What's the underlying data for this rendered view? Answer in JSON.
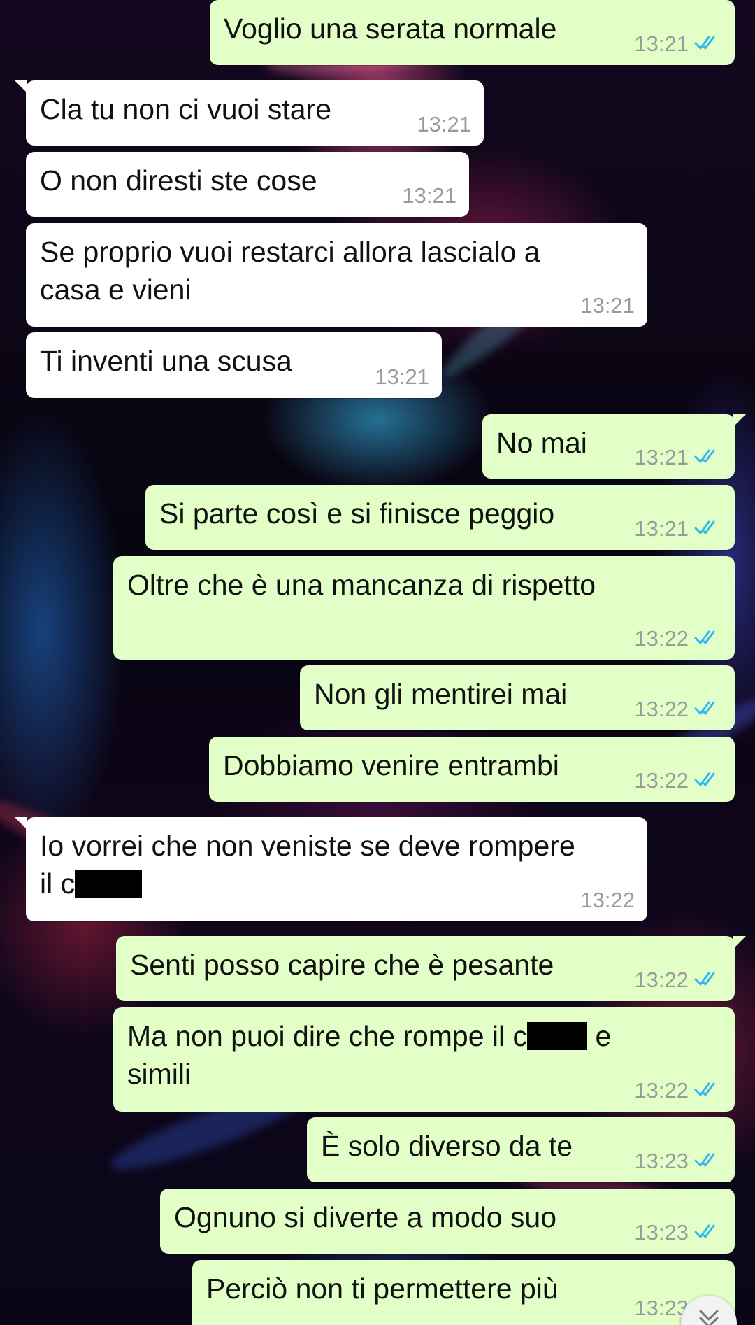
{
  "messages": [
    {
      "dir": "out",
      "text": "Voglio una serata normale",
      "time": "13:21",
      "status": "read"
    },
    {
      "dir": "in",
      "text": "Cla tu non ci vuoi stare",
      "time": "13:21"
    },
    {
      "dir": "in",
      "text": "O non diresti ste cose",
      "time": "13:21"
    },
    {
      "dir": "in",
      "line1": "Se proprio vuoi restarci allora lascialo a",
      "line2": "casa e vieni",
      "time": "13:21"
    },
    {
      "dir": "in",
      "text": "Ti inventi una scusa",
      "time": "13:21"
    },
    {
      "dir": "out",
      "text": "No mai",
      "time": "13:21",
      "status": "read"
    },
    {
      "dir": "out",
      "text": "Si parte così e si finisce peggio",
      "time": "13:21",
      "status": "read"
    },
    {
      "dir": "out",
      "text": "Oltre che è una mancanza di rispetto",
      "time": "13:22",
      "status": "read"
    },
    {
      "dir": "out",
      "text": "Non gli mentirei mai",
      "time": "13:22",
      "status": "read"
    },
    {
      "dir": "out",
      "text": "Dobbiamo venire entrambi",
      "time": "13:22",
      "status": "read"
    },
    {
      "dir": "in",
      "line1": "Io vorrei che non veniste se deve rompere",
      "line2_prefix": "il c",
      "time": "13:22"
    },
    {
      "dir": "out",
      "text": "Senti posso capire che è pesante",
      "time": "13:22",
      "status": "read"
    },
    {
      "dir": "out",
      "line1_prefix": "Ma non puoi dire che rompe il c",
      "line1_suffix": "e",
      "line2": "simili",
      "time": "13:22",
      "status": "read"
    },
    {
      "dir": "out",
      "text": "È solo diverso da te",
      "time": "13:23",
      "status": "read"
    },
    {
      "dir": "out",
      "text": "Ognuno si diverte a modo suo",
      "time": "13:23",
      "status": "read"
    },
    {
      "dir": "out",
      "text": "Perciò non ti permettere più",
      "time": "13:23",
      "status": "read"
    }
  ],
  "icons": {
    "read_receipt": "double-check-icon",
    "scroll_down": "chevron-down-icon"
  },
  "colors": {
    "incoming_bubble": "#ffffff",
    "outgoing_bubble": "#e1ffc7",
    "read_ticks": "#34b7f1",
    "timestamp": "#9a9a9a"
  }
}
